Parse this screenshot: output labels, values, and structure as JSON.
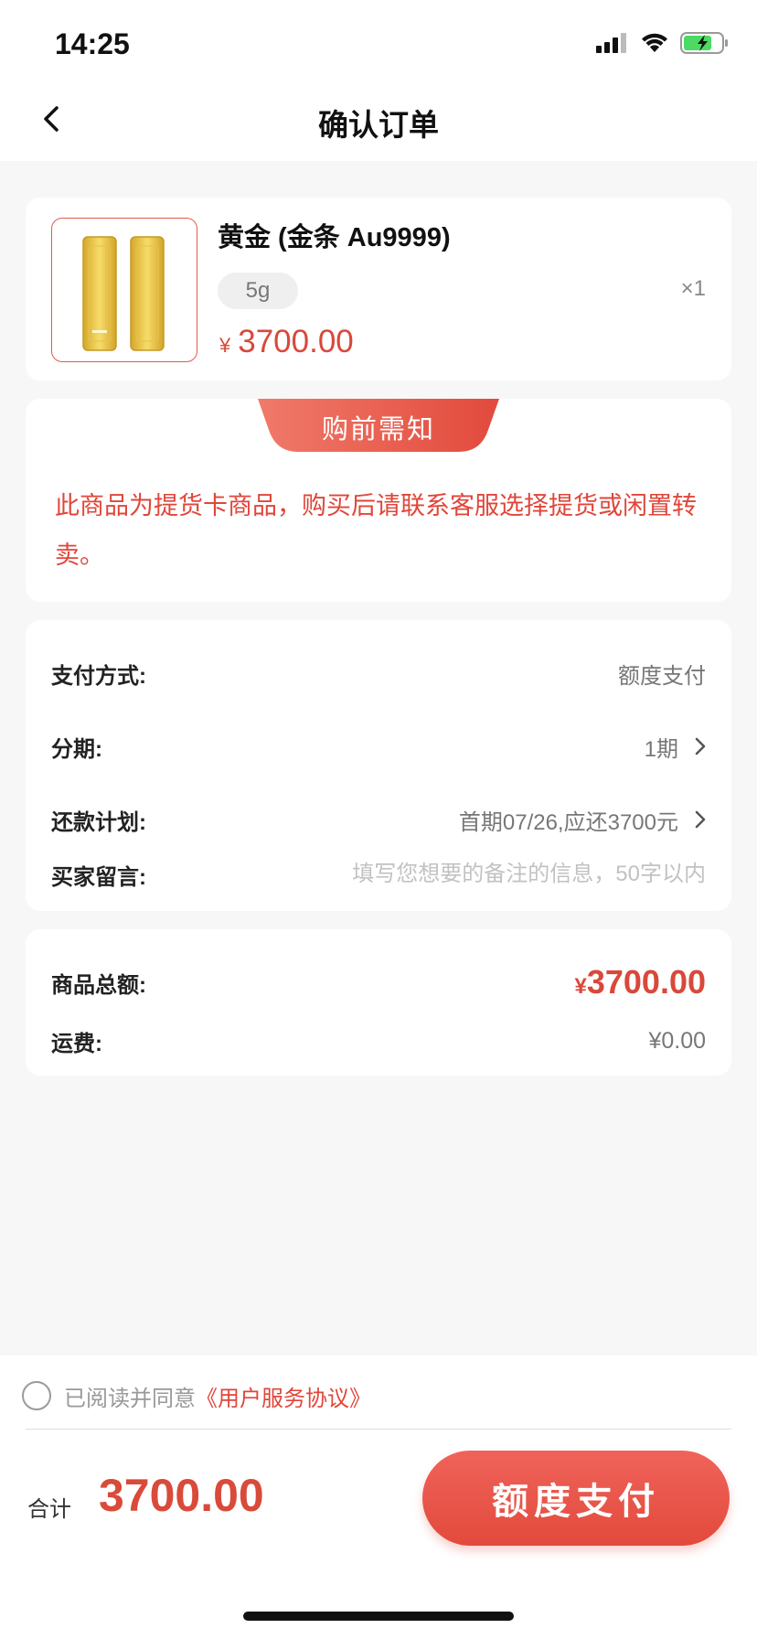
{
  "status_bar": {
    "time": "14:25",
    "icons": [
      "signal-icon",
      "wifi-icon",
      "battery-charging-icon"
    ]
  },
  "nav": {
    "title": "确认订单",
    "back_icon": "chevron-left-icon"
  },
  "product": {
    "name": "黄金 (金条 Au9999)",
    "spec": "5g",
    "quantity": "×1",
    "currency": "¥",
    "price": "3700.00",
    "image_icon": "gold-bars-image"
  },
  "notice": {
    "title": "购前需知",
    "text": "此商品为提货卡商品，购买后请联系客服选择提货或闲置转卖。"
  },
  "payment": {
    "method_label": "支付方式:",
    "method_value": "额度支付",
    "installment_label": "分期:",
    "installment_value": "1期",
    "plan_label": "还款计划:",
    "plan_value": "首期07/26,应还3700元",
    "remark_label": "买家留言:",
    "remark_placeholder": "填写您想要的备注的信息，50字以内",
    "remark_value": ""
  },
  "totals": {
    "goods_label": "商品总额:",
    "goods_currency": "¥",
    "goods_amount": "3700.00",
    "shipping_label": "运费:",
    "shipping_value": "¥0.00"
  },
  "footer": {
    "agree_text": "已阅读并同意",
    "agree_link": "《用户服务协议》",
    "sum_label": "合计",
    "sum_amount": "3700.00",
    "pay_button": "额度支付"
  },
  "colors": {
    "accent": "#e0463a",
    "background": "#f7f7f7"
  }
}
